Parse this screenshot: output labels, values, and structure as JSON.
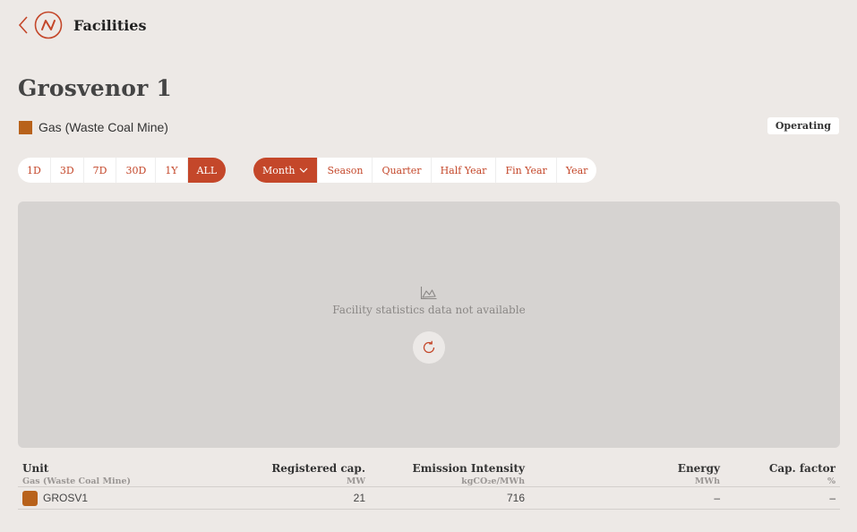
{
  "header": {
    "title": "Facilities"
  },
  "facility": {
    "name": "Grosvenor 1",
    "fuel": "Gas (Waste Coal Mine)",
    "status": "Operating",
    "colors": {
      "fuel": "#b8621b",
      "accent": "#c4472a"
    }
  },
  "ranges": [
    "1D",
    "3D",
    "7D",
    "30D",
    "1Y",
    "ALL"
  ],
  "active_range": "ALL",
  "intervals": [
    "Month",
    "Season",
    "Quarter",
    "Half Year",
    "Fin Year",
    "Year"
  ],
  "active_interval": "Month",
  "chart": {
    "empty_message": "Facility statistics data not available"
  },
  "table": {
    "headers": [
      {
        "label": "Unit",
        "sub": "Gas (Waste Coal Mine)"
      },
      {
        "label": "Registered cap.",
        "sub": "MW"
      },
      {
        "label": "Emission Intensity",
        "sub": "kgCO₂e/MWh"
      },
      {
        "label": "Energy",
        "sub": "MWh"
      },
      {
        "label": "Cap. factor",
        "sub": "%"
      }
    ],
    "rows": [
      {
        "unit": "GROSV1",
        "capacity": "21",
        "intensity": "716",
        "energy": "–",
        "cap_factor": "–"
      }
    ]
  }
}
